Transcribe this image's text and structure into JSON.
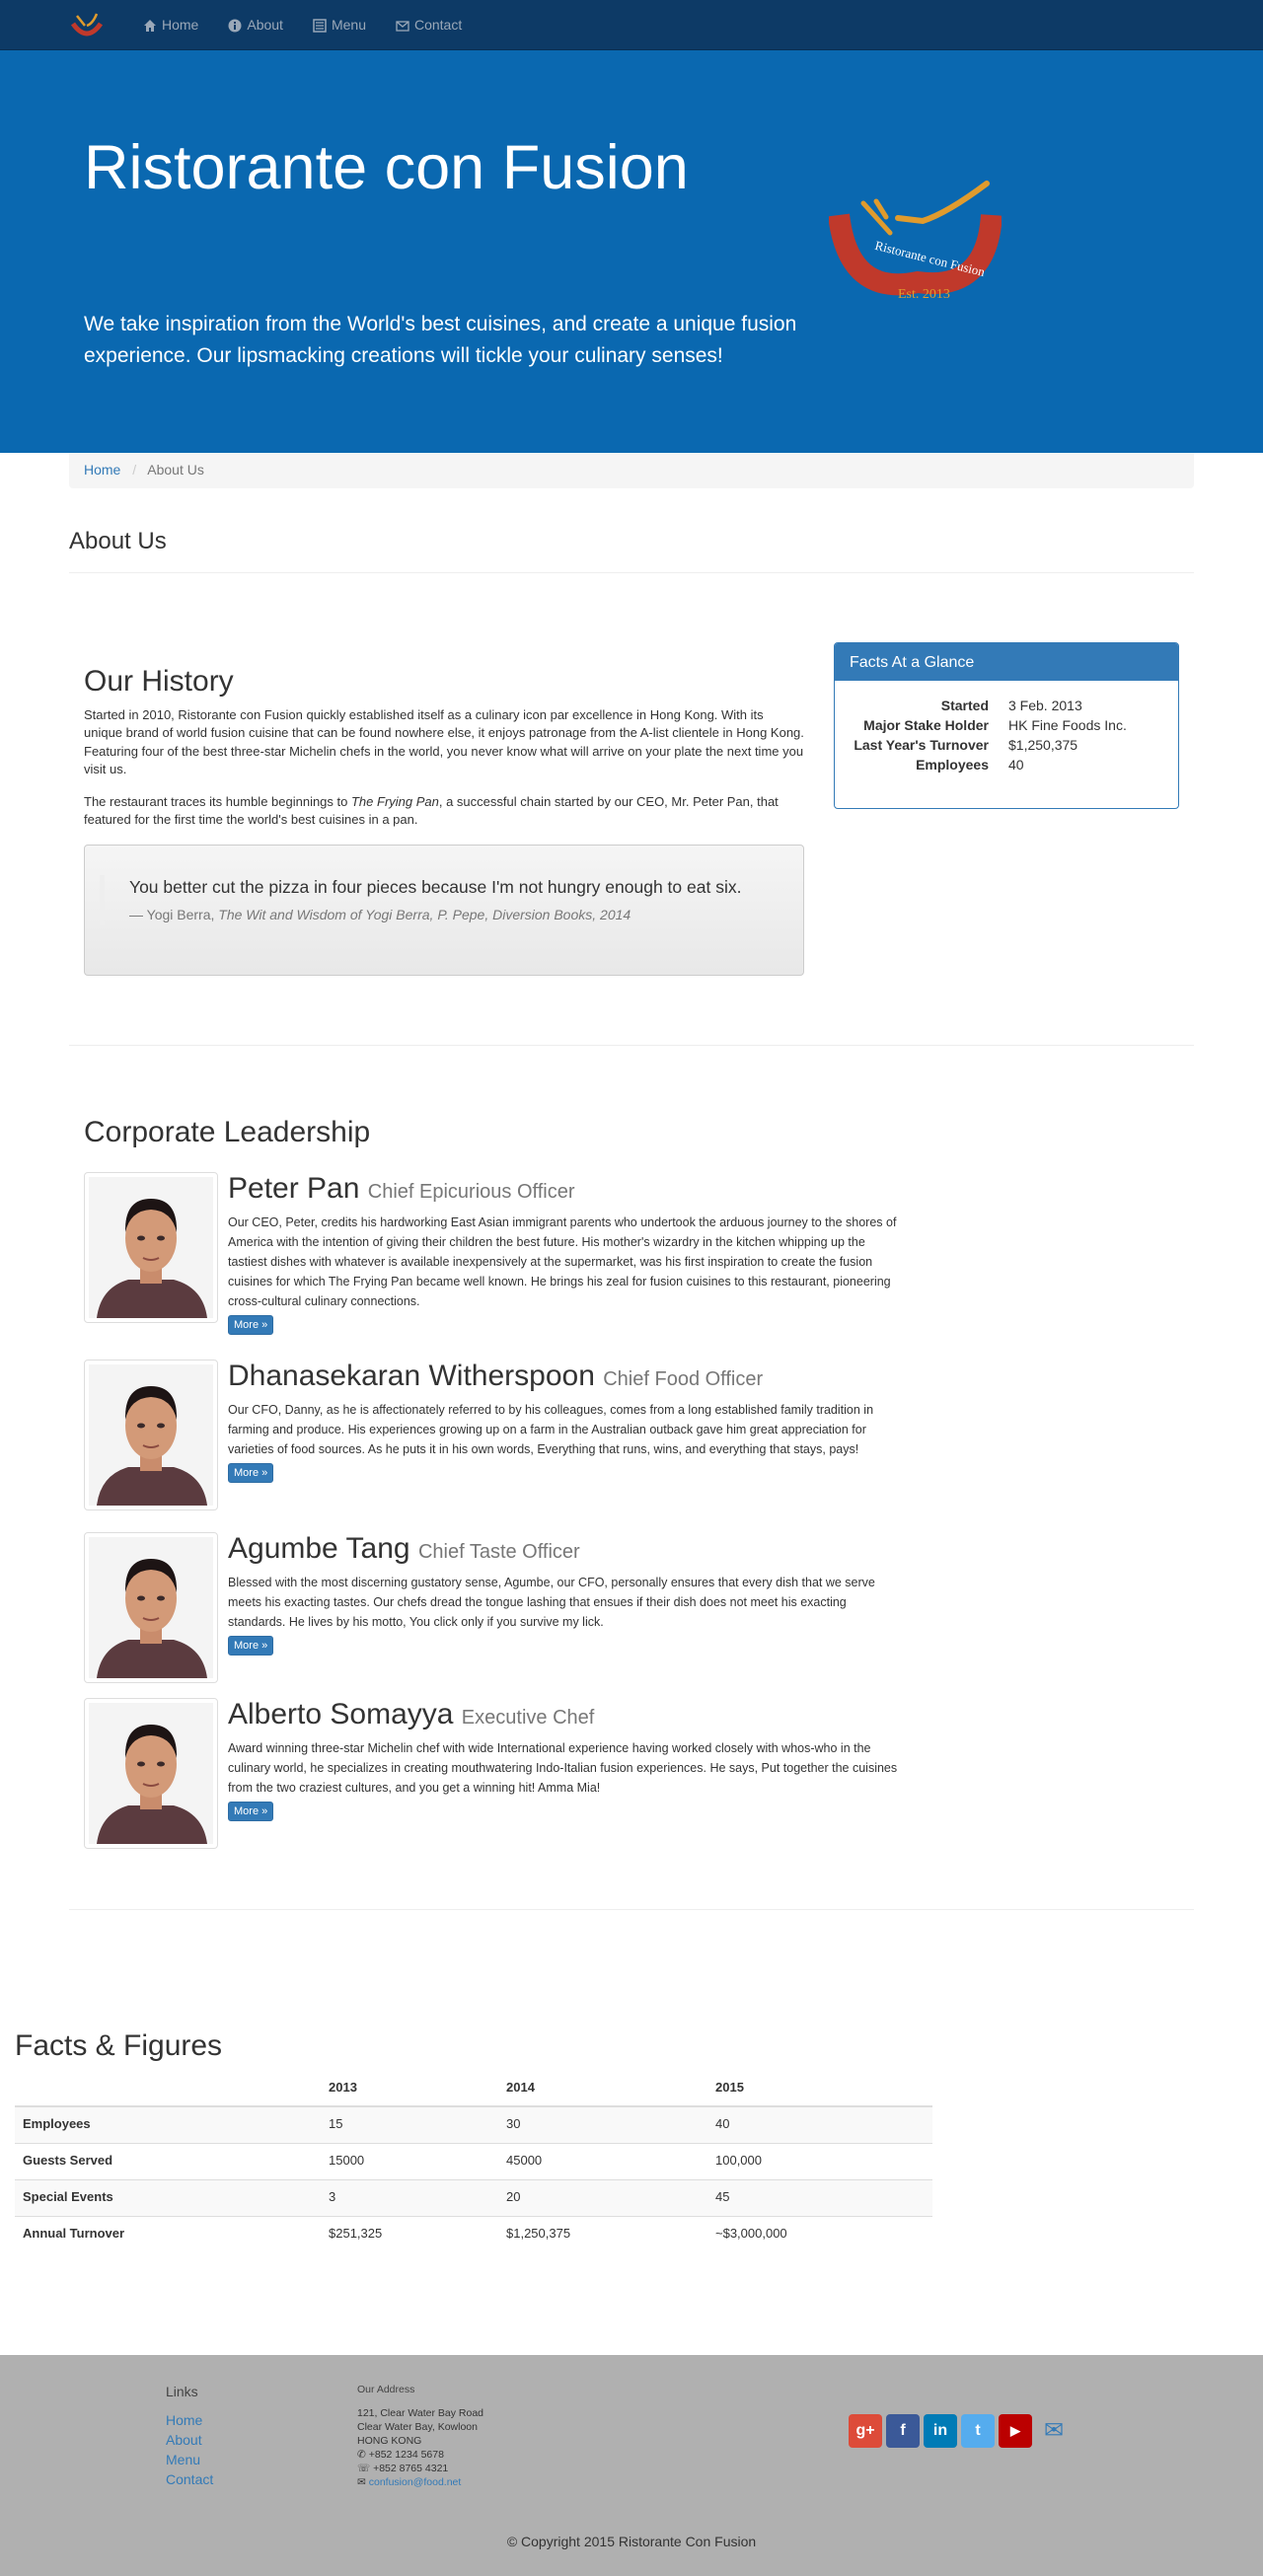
{
  "nav": {
    "items": [
      {
        "label": "Home",
        "icon": "home-icon"
      },
      {
        "label": "About",
        "icon": "info-icon"
      },
      {
        "label": "Menu",
        "icon": "list-icon"
      },
      {
        "label": "Contact",
        "icon": "envelope-icon"
      }
    ]
  },
  "jumbotron": {
    "title": "Ristorante con Fusion",
    "tagline": "We take inspiration from the World's best cuisines, and create a unique fusion experience. Our lipsmacking creations will tickle your culinary senses!",
    "logo_text": "Ristorante con Fusion",
    "logo_est": "Est. 2013"
  },
  "breadcrumb": {
    "home": "Home",
    "current": "About Us"
  },
  "page_title": "About Us",
  "history": {
    "title": "Our History",
    "p1": "Started in 2010, Ristorante con Fusion quickly established itself as a culinary icon par excellence in Hong Kong. With its unique brand of world fusion cuisine that can be found nowhere else, it enjoys patronage from the A-list clientele in Hong Kong. Featuring four of the best three-star Michelin chefs in the world, you never know what will arrive on your plate the next time you visit us.",
    "p2_before": "The restaurant traces its humble beginnings to ",
    "p2_italic": "The Frying Pan",
    "p2_after": ", a successful chain started by our CEO, Mr. Peter Pan, that featured for the first time the world's best cuisines in a pan.",
    "quote": "You better cut the pizza in four pieces because I'm not hungry enough to eat six.",
    "quote_author": "— Yogi Berra, ",
    "quote_source": "The Wit and Wisdom of Yogi Berra, P. Pepe, Diversion Books, 2014"
  },
  "facts_panel": {
    "title": "Facts At a Glance",
    "rows": [
      {
        "label": "Started",
        "value": "3 Feb. 2013"
      },
      {
        "label": "Major Stake Holder",
        "value": "HK Fine Foods Inc."
      },
      {
        "label": "Last Year's Turnover",
        "value": "$1,250,375"
      },
      {
        "label": "Employees",
        "value": "40"
      }
    ]
  },
  "leadership": {
    "title": "Corporate Leadership",
    "more_label": "More »",
    "leaders": [
      {
        "name": "Peter Pan",
        "role": "Chief Epicurious Officer",
        "bio": "Our CEO, Peter, credits his hardworking East Asian immigrant parents who undertook the arduous journey to the shores of America with the intention of giving their children the best future. His mother's wizardry in the kitchen whipping up the tastiest dishes with whatever is available inexpensively at the supermarket, was his first inspiration to create the fusion cuisines for which The Frying Pan became well known. He brings his zeal for fusion cuisines to this restaurant, pioneering cross-cultural culinary connections."
      },
      {
        "name": "Dhanasekaran Witherspoon",
        "role": "Chief Food Officer",
        "bio": "Our CFO, Danny, as he is affectionately referred to by his colleagues, comes from a long established family tradition in farming and produce. His experiences growing up on a farm in the Australian outback gave him great appreciation for varieties of food sources. As he puts it in his own words, Everything that runs, wins, and everything that stays, pays!"
      },
      {
        "name": "Agumbe Tang",
        "role": "Chief Taste Officer",
        "bio": "Blessed with the most discerning gustatory sense, Agumbe, our CFO, personally ensures that every dish that we serve meets his exacting tastes. Our chefs dread the tongue lashing that ensues if their dish does not meet his exacting standards. He lives by his motto, You click only if you survive my lick."
      },
      {
        "name": "Alberto Somayya",
        "role": "Executive Chef",
        "bio": "Award winning three-star Michelin chef with wide International experience having worked closely with whos-who in the culinary world, he specializes in creating mouthwatering Indo-Italian fusion experiences. He says, Put together the cuisines from the two craziest cultures, and you get a winning hit! Amma Mia!"
      }
    ]
  },
  "figures": {
    "title": "Facts & Figures",
    "headers": [
      "",
      "2013",
      "2014",
      "2015"
    ],
    "rows": [
      [
        "Employees",
        "15",
        "30",
        "40"
      ],
      [
        "Guests Served",
        "15000",
        "45000",
        "100,000"
      ],
      [
        "Special Events",
        "3",
        "20",
        "45"
      ],
      [
        "Annual Turnover",
        "$251,325",
        "$1,250,375",
        "~$3,000,000"
      ]
    ]
  },
  "footer": {
    "links_title": "Links",
    "links": [
      "Home",
      "About",
      "Menu",
      "Contact"
    ],
    "address_title": "Our Address",
    "address": [
      "121, Clear Water Bay Road",
      "Clear Water Bay, Kowloon",
      "HONG KONG"
    ],
    "phone": "+852 1234 5678",
    "fax": "+852 8765 4321",
    "email": "confusion@food.net",
    "socials": [
      {
        "name": "google-plus",
        "glyph": "g+",
        "color": "#dd4b39"
      },
      {
        "name": "facebook",
        "glyph": "f",
        "color": "#3b5998"
      },
      {
        "name": "linkedin",
        "glyph": "in",
        "color": "#007bb6"
      },
      {
        "name": "twitter",
        "glyph": "t",
        "color": "#55acee"
      },
      {
        "name": "youtube",
        "glyph": "▶",
        "color": "#bb0000"
      }
    ],
    "copyright": "© Copyright 2015 Ristorante Con Fusion"
  }
}
